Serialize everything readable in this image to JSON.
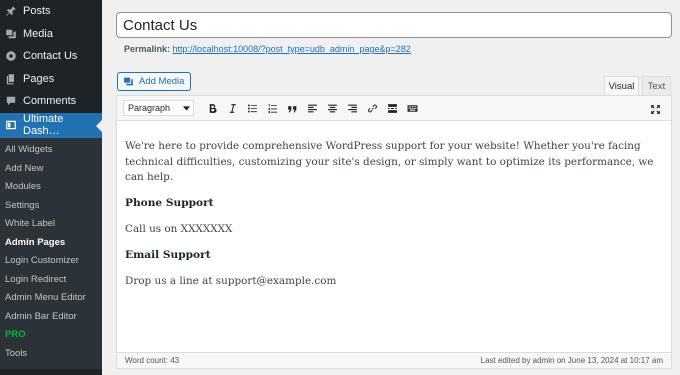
{
  "sidebar": {
    "items": [
      {
        "label": "Posts",
        "icon": "pin-icon"
      },
      {
        "label": "Media",
        "icon": "media-icon"
      },
      {
        "label": "Contact Us",
        "icon": "gear-icon"
      },
      {
        "label": "Pages",
        "icon": "pages-icon"
      },
      {
        "label": "Comments",
        "icon": "comment-icon"
      }
    ],
    "active": {
      "label": "Ultimate Dash…",
      "icon": "dashboard-icon"
    },
    "submenu": [
      "All Widgets",
      "Add New",
      "Modules",
      "Settings",
      "White Label",
      "Admin Pages",
      "Login Customizer",
      "Login Redirect",
      "Admin Menu Editor",
      "Admin Bar Editor",
      "PRO",
      "Tools"
    ]
  },
  "post": {
    "title": "Contact Us",
    "permalink_label": "Permalink:",
    "permalink_url": "http://localhost:10008/?post_type=udb_admin_page&p=282"
  },
  "editor": {
    "add_media_label": "Add Media",
    "tab_visual": "Visual",
    "tab_text": "Text",
    "format_value": "Paragraph",
    "content": {
      "intro": "We're here to provide comprehensive WordPress support for your website! Whether you're facing technical difficulties, customizing your site's design, or simply want to optimize its performance, we can help.",
      "phone_heading": "Phone Support",
      "phone_text": "Call us on XXXXXXX",
      "email_heading": "Email Support",
      "email_text": "Drop us a line at support@example.com"
    },
    "word_count": "Word count: 43",
    "last_edited": "Last edited by admin on June 13, 2024 at 10:17 am"
  },
  "colors": {
    "sidebar_bg": "#1d2327",
    "submenu_bg": "#2c3338",
    "accent": "#2271b1",
    "pro": "#00ba37"
  }
}
